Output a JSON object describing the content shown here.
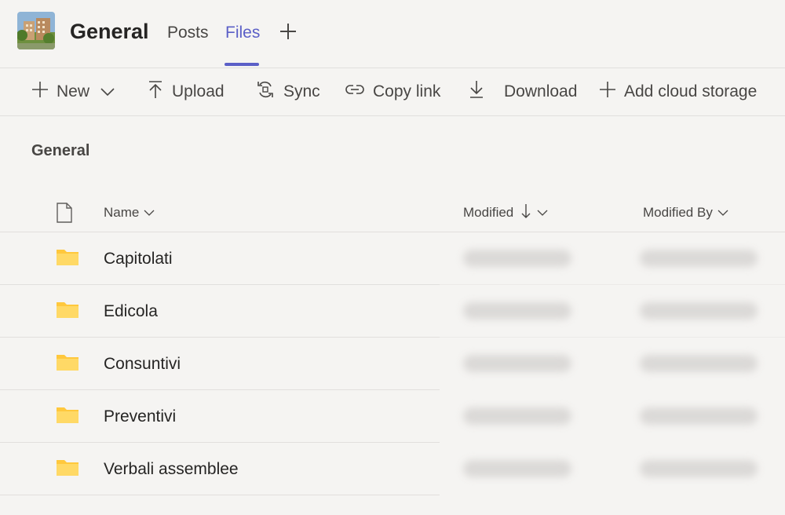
{
  "header": {
    "team_name": "General",
    "tabs": [
      {
        "label": "Posts",
        "active": false
      },
      {
        "label": "Files",
        "active": true
      }
    ],
    "accent_color": "#5b5fc7"
  },
  "toolbar": {
    "items": [
      {
        "label": "New",
        "icon": "plus-icon",
        "has_dropdown": true
      },
      {
        "label": "Upload",
        "icon": "upload-icon"
      },
      {
        "label": "Sync",
        "icon": "sync-icon"
      },
      {
        "label": "Copy link",
        "icon": "link-icon"
      },
      {
        "label": "Download",
        "icon": "download-icon"
      },
      {
        "label": "Add cloud storage",
        "icon": "plus-icon"
      }
    ]
  },
  "breadcrumb": "General",
  "table": {
    "columns": [
      {
        "label": "Name",
        "sort": "none"
      },
      {
        "label": "Modified",
        "sort": "descending"
      },
      {
        "label": "Modified By",
        "sort": "none"
      }
    ],
    "rows": [
      {
        "name": "Capitolati",
        "type": "folder"
      },
      {
        "name": "Edicola",
        "type": "folder"
      },
      {
        "name": "Consuntivi",
        "type": "folder"
      },
      {
        "name": "Preventivi",
        "type": "folder"
      },
      {
        "name": "Verbali assemblee",
        "type": "folder"
      }
    ],
    "folder_color": "#ffc83d"
  }
}
